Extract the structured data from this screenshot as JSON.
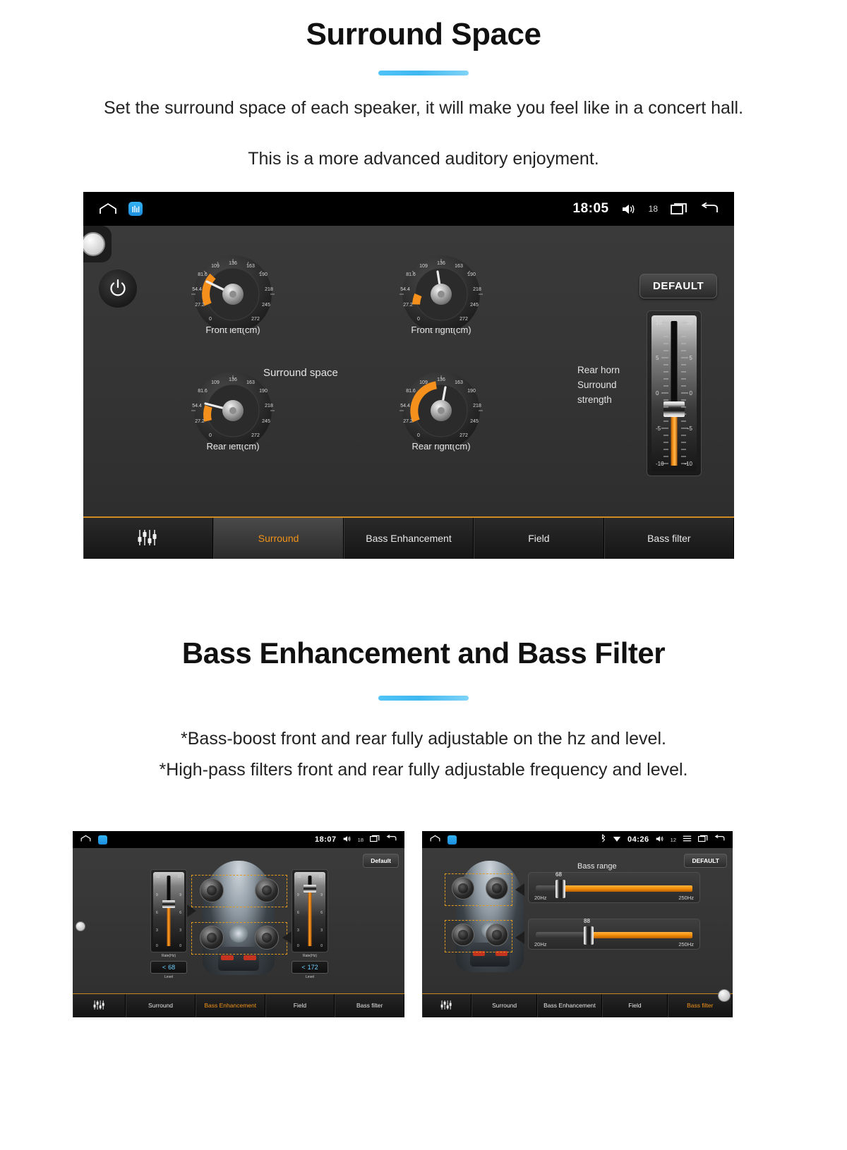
{
  "sections": [
    {
      "title": "Surround Space",
      "paragraphs": [
        "Set the surround space of each speaker, it will make you feel like in a concert hall.",
        "This is a more advanced auditory enjoyment."
      ]
    },
    {
      "title": "Bass Enhancement and Bass Filter",
      "paragraphs": [
        "*Bass-boost front and rear fully adjustable on the hz and level.",
        "*High-pass filters front and rear fully adjustable frequency and level."
      ]
    }
  ],
  "surround_screen": {
    "status_bar": {
      "home_icon": "home-icon",
      "app_icon": "equalizer-app-icon",
      "time": "18:05",
      "volume_icon": "speaker-icon",
      "volume_value": "18",
      "recents_icon": "recents-icon",
      "back_icon": "back-icon"
    },
    "default_button": "DEFAULT",
    "center_caption": "Surround space",
    "rear_horn_label": "Rear horn\nSurround\nstrength",
    "rear_horn_lines": [
      "Rear horn",
      "Surround",
      "strength"
    ],
    "dials": [
      {
        "label": "Front left(cm)",
        "value": 62,
        "angle_deg": -15
      },
      {
        "label": "Front right(cm)",
        "value": 28,
        "angle_deg": -55
      },
      {
        "label": "Rear left(cm)",
        "value": 36,
        "angle_deg": -32
      },
      {
        "label": "Rear right(cm)",
        "value": 120,
        "angle_deg": 10
      }
    ],
    "dial_ticks": [
      "0",
      "27.2",
      "54.4",
      "81.6",
      "109",
      "136",
      "163",
      "190",
      "218",
      "245",
      "272"
    ],
    "vertical_slider": {
      "scale": [
        "10",
        "5",
        "0",
        "-5",
        "-10"
      ],
      "value": -1.5
    },
    "tabs": [
      {
        "label": "",
        "icon": "equalizer-icon",
        "active": false
      },
      {
        "label": "Surround",
        "active": true
      },
      {
        "label": "Bass Enhancement",
        "active": false
      },
      {
        "label": "Field",
        "active": false
      },
      {
        "label": "Bass filter",
        "active": false
      }
    ]
  },
  "bass_screen": {
    "status_bar": {
      "time": "18:07",
      "volume_value": "18"
    },
    "default_button": "Default",
    "tabs": [
      {
        "label": "",
        "icon": "equalizer-icon",
        "active": false
      },
      {
        "label": "Surround",
        "active": false
      },
      {
        "label": "Bass Enhancement",
        "active": true
      },
      {
        "label": "Field",
        "active": false
      },
      {
        "label": "Bass filter",
        "active": false
      }
    ],
    "left_slider": {
      "scale": [
        "12",
        "9",
        "6",
        "3",
        "0"
      ],
      "caption": "Rate(Hz)",
      "value_label": "68",
      "level_label": "Level"
    },
    "right_slider": {
      "scale": [
        "12",
        "9",
        "6",
        "3",
        "0"
      ],
      "caption": "Rate(Hz)",
      "value_label": "172",
      "level_label": "Level"
    }
  },
  "filter_screen": {
    "status_bar": {
      "bluetooth_icon": "bluetooth-icon",
      "wifi_icon": "wifi-icon",
      "time": "04:26",
      "volume_value": "12",
      "menu_icon": "menu-icon",
      "recents_icon": "recents-icon",
      "back_icon": "back-icon"
    },
    "default_button": "DEFAULT",
    "title": "Bass range",
    "sliders": [
      {
        "value": "68",
        "min_label": "20Hz",
        "max_label": "250Hz",
        "percent": 16
      },
      {
        "value": "88",
        "min_label": "20Hz",
        "max_label": "250Hz",
        "percent": 32
      }
    ],
    "tabs": [
      {
        "label": "",
        "icon": "equalizer-icon",
        "active": false
      },
      {
        "label": "Surround",
        "active": false
      },
      {
        "label": "Bass Enhancement",
        "active": false
      },
      {
        "label": "Field",
        "active": false
      },
      {
        "label": "Bass filter",
        "active": true
      }
    ]
  },
  "colors": {
    "accent_orange": "#f29318",
    "divider_blue": "#4fc3f7",
    "screen_bg": "#353535"
  }
}
